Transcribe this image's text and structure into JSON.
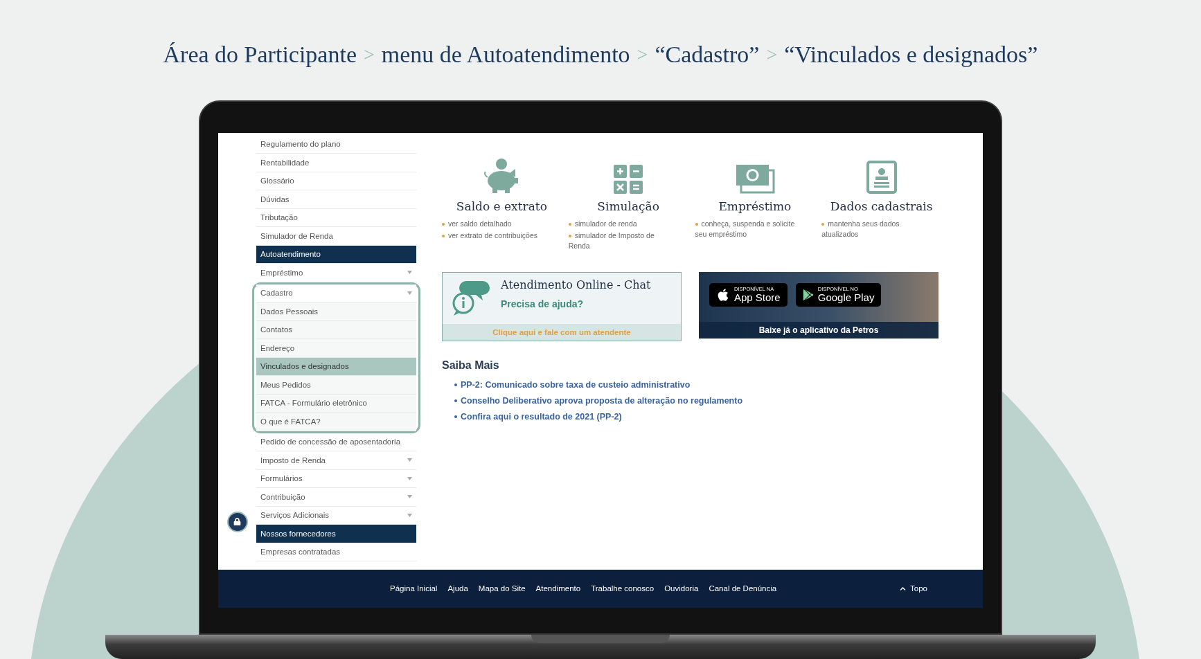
{
  "breadcrumb": [
    {
      "label": "Área do Participante"
    },
    {
      "label": "menu de Autoatendimento"
    },
    {
      "label": "“Cadastro”"
    },
    {
      "label": "“Vinculados e designados”"
    }
  ],
  "breadcrumb_separator": ">",
  "sidebar": {
    "items": [
      {
        "label": "Regulamento do plano",
        "kind": "link",
        "expandable": false,
        "selected": false
      },
      {
        "label": "Rentabilidade",
        "kind": "link",
        "expandable": false,
        "selected": false
      },
      {
        "label": "Glossário",
        "kind": "link",
        "expandable": false,
        "selected": false
      },
      {
        "label": "Dúvidas",
        "kind": "link",
        "expandable": false,
        "selected": false
      },
      {
        "label": "Tributação",
        "kind": "link",
        "expandable": false,
        "selected": false
      },
      {
        "label": "Simulador de Renda",
        "kind": "link",
        "expandable": false,
        "selected": false
      },
      {
        "label": "Autoatendimento",
        "kind": "heading",
        "expandable": false,
        "selected": false
      },
      {
        "label": "Empréstimo",
        "kind": "link",
        "expandable": true,
        "selected": false
      },
      {
        "label": "Cadastro",
        "kind": "link",
        "expandable": true,
        "selected": false,
        "expanded": true,
        "outlined": true,
        "children": [
          {
            "label": "Dados Pessoais",
            "selected": false
          },
          {
            "label": "Contatos",
            "selected": false
          },
          {
            "label": "Endereço",
            "selected": false
          },
          {
            "label": "Vinculados e designados",
            "selected": true
          },
          {
            "label": "Meus Pedidos",
            "selected": false
          },
          {
            "label": "FATCA - Formulário eletrônico",
            "selected": false
          },
          {
            "label": "O que é FATCA?",
            "selected": false
          }
        ]
      },
      {
        "label": "Pedido de concessão de aposentadoria",
        "kind": "link",
        "expandable": false,
        "selected": false
      },
      {
        "label": "Imposto de Renda",
        "kind": "link",
        "expandable": true,
        "selected": false
      },
      {
        "label": "Formulários",
        "kind": "link",
        "expandable": true,
        "selected": false
      },
      {
        "label": "Contribuição",
        "kind": "link",
        "expandable": true,
        "selected": false
      },
      {
        "label": "Serviços Adicionais",
        "kind": "link",
        "expandable": true,
        "selected": false
      },
      {
        "label": "Nossos fornecedores",
        "kind": "heading",
        "expandable": false,
        "selected": false
      },
      {
        "label": "Empresas contratadas",
        "kind": "link",
        "expandable": false,
        "selected": false
      }
    ]
  },
  "features": [
    {
      "kind": "piggy",
      "title": "Saldo e extrato",
      "bullets": [
        "ver saldo detalhado",
        "ver extrato de contribuições"
      ]
    },
    {
      "kind": "calculator",
      "title": "Simulação",
      "bullets": [
        "simulador de renda",
        "simulador de Imposto de Renda"
      ]
    },
    {
      "kind": "money",
      "title": "Empréstimo",
      "bullets": [
        "conheça, suspenda e solicite seu empréstimo"
      ]
    },
    {
      "kind": "profile",
      "title": "Dados cadastrais",
      "bullets": [
        "mantenha seus dados atualizados"
      ]
    }
  ],
  "chat_banner": {
    "title": "Atendimento Online - Chat",
    "subtitle": "Precisa de ajuda?",
    "action": "Clique aqui e fale com um atendente"
  },
  "app_banner": {
    "stores": [
      {
        "kind": "apple",
        "small": "DISPONÍVEL NA",
        "name": "App Store"
      },
      {
        "kind": "google",
        "small": "DISPONÍVEL NO",
        "name": "Google Play"
      }
    ],
    "caption": "Baixe já o aplicativo da Petros"
  },
  "news": {
    "title": "Saiba Mais",
    "links": [
      "PP-2: Comunicado sobre taxa de custeio administrativo",
      "Conselho Deliberativo aprova proposta de alteração no regulamento",
      "Confira aqui o resultado de 2021 (PP-2)"
    ]
  },
  "footer": {
    "links": [
      "Página Inicial",
      "Ajuda",
      "Mapa do Site",
      "Atendimento",
      "Trabalhe conosco",
      "Ouvidoria",
      "Canal de Denúncia"
    ],
    "top_link": "Topo"
  }
}
